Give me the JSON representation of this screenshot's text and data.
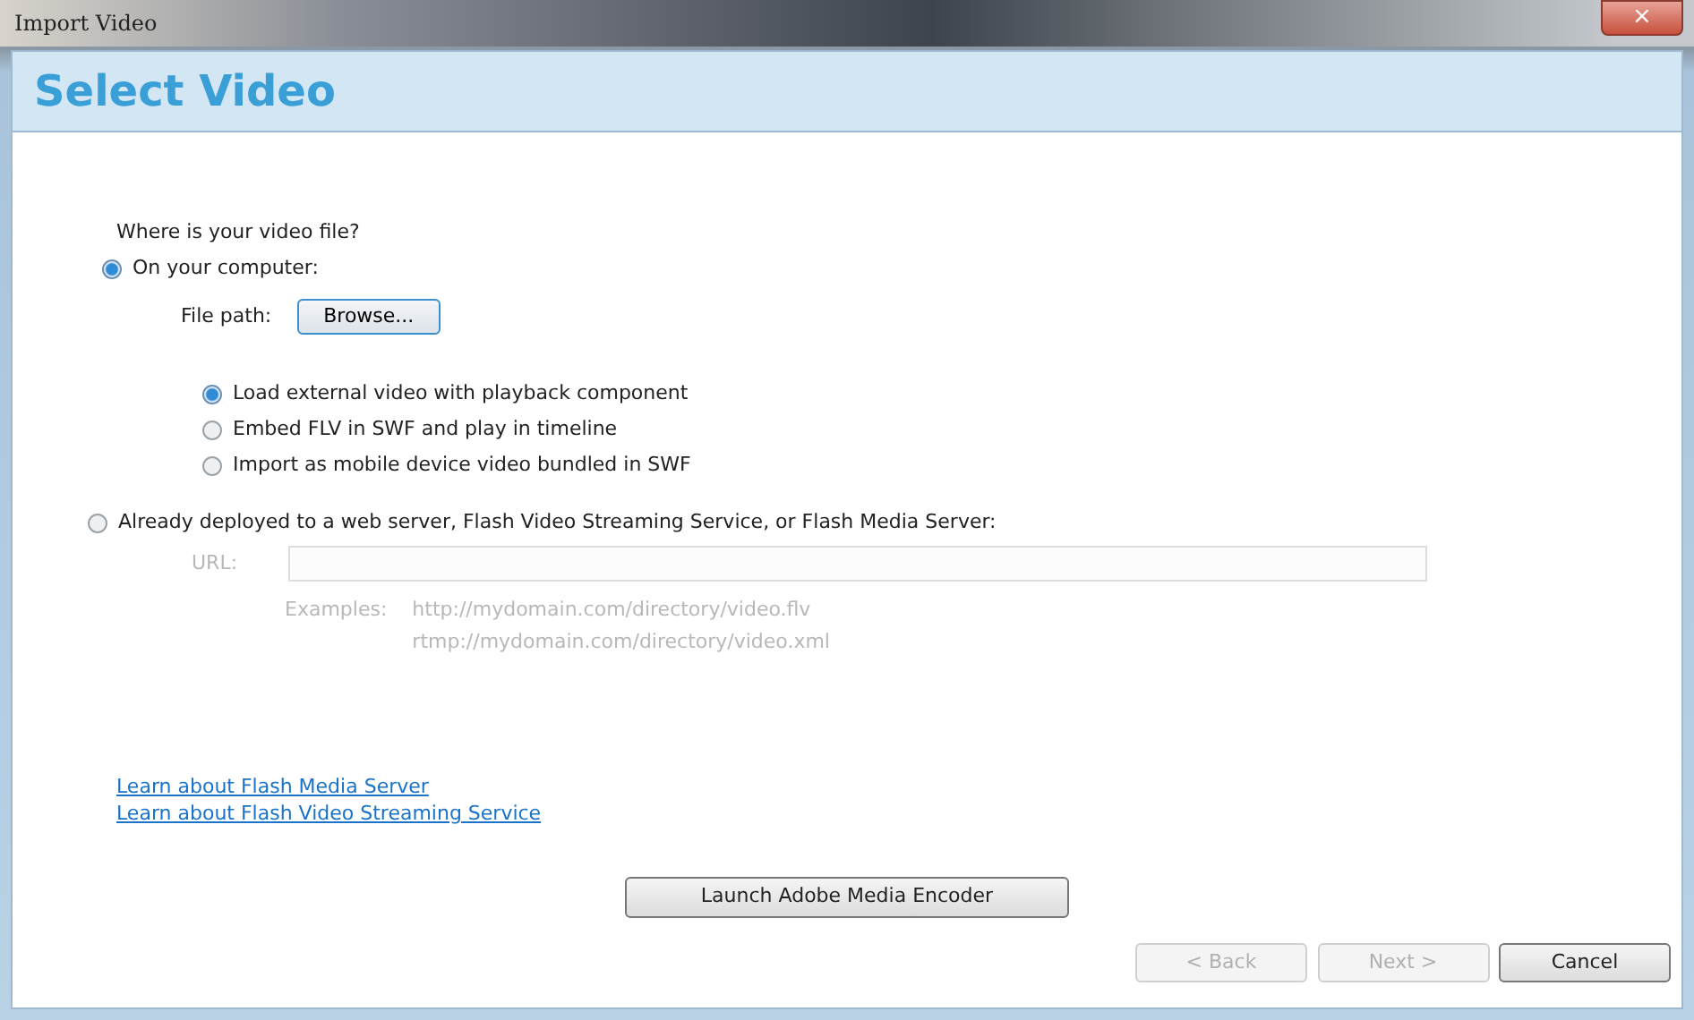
{
  "window": {
    "title": "Import Video",
    "close": "×"
  },
  "header": {
    "title": "Select Video"
  },
  "question": "Where is your video file?",
  "source_options": [
    {
      "label": "On your computer:",
      "selected": true
    },
    {
      "label": "Already deployed to a web server, Flash Video Streaming Service, or Flash Media Server:",
      "selected": false
    }
  ],
  "file_path": {
    "label": "File path:",
    "button": "Browse..."
  },
  "deployment_options": [
    {
      "label": "Load external video with playback component",
      "selected": true
    },
    {
      "label": "Embed FLV in SWF and play in timeline",
      "selected": false
    },
    {
      "label": "Import as mobile device video bundled in SWF",
      "selected": false
    }
  ],
  "url": {
    "label": "URL:",
    "disabled": true,
    "examples_label": "Examples:",
    "examples": [
      "http://mydomain.com/directory/video.flv",
      "rtmp://mydomain.com/directory/video.xml"
    ]
  },
  "links": [
    "Learn about Flash Media Server",
    "Learn about Flash Video Streaming Service"
  ],
  "encoder_button": "Launch Adobe Media Encoder",
  "buttons": [
    {
      "label": "< Back",
      "disabled": true
    },
    {
      "label": "Next >",
      "disabled": true
    },
    {
      "label": "Cancel",
      "disabled": false
    }
  ]
}
